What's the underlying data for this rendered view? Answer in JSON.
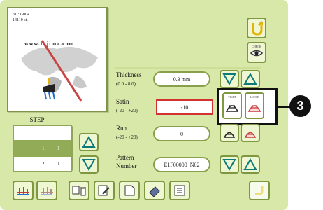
{
  "preview": {
    "line1": "31 : G004",
    "line2": "14110 st.",
    "url": "www.tajima.com"
  },
  "step": {
    "title": "STEP",
    "rows": [
      {
        "a": "",
        "b": ""
      },
      {
        "a": "1",
        "b": "1"
      },
      {
        "a": "2",
        "b": "1"
      }
    ]
  },
  "settings": {
    "thickness": {
      "label": "Thickness",
      "range": "(0.0 - 8.0)",
      "value": "0.3 mm"
    },
    "satin": {
      "label": "Satin",
      "range": "(-20 - +20)",
      "value": "-10"
    },
    "run": {
      "label": "Run",
      "range": "(-20 - +20)",
      "value": "0"
    },
    "pattern": {
      "label": "Pattern",
      "label2": "Number",
      "value": "E1F00000_N02"
    }
  },
  "buttons": {
    "check_label": "CHECK",
    "tight_label": "TIGHT",
    "loose_label": "LOOSE"
  },
  "callout": {
    "number": "3"
  },
  "colors": {
    "panel": "#d8e8a8",
    "highlight": "#d23131",
    "callout": "#111111"
  }
}
